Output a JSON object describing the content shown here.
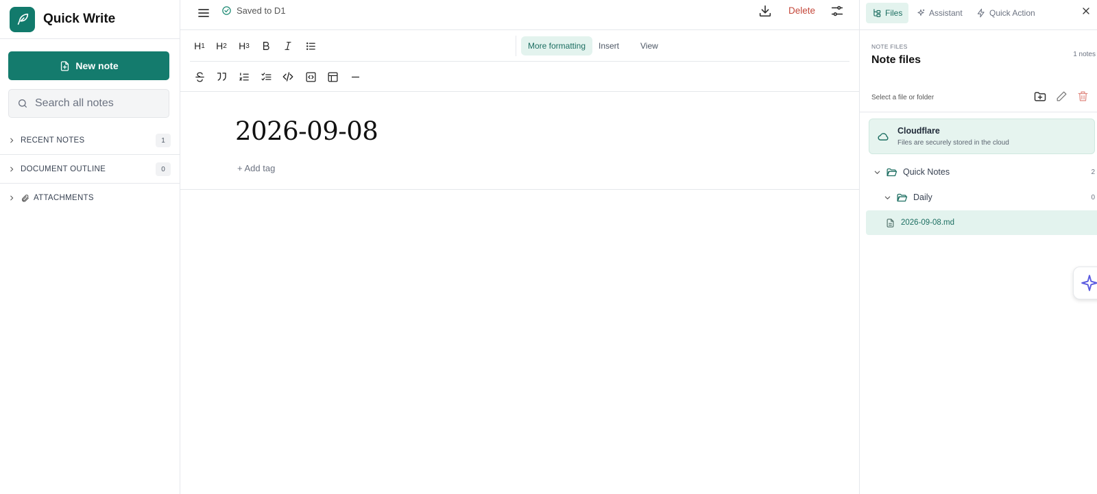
{
  "app": {
    "title": "Quick Write"
  },
  "sidebar": {
    "new_note_label": "New note",
    "search_placeholder": "Search all notes",
    "sections": [
      {
        "label": "RECENT NOTES",
        "count": "1"
      },
      {
        "label": "DOCUMENT OUTLINE",
        "count": "0"
      },
      {
        "label": "ATTACHMENTS"
      }
    ]
  },
  "topbar": {
    "status": "Saved to D1",
    "delete_label": "Delete"
  },
  "toolbar": {
    "headings": [
      {
        "base": "H",
        "level": "1"
      },
      {
        "base": "H",
        "level": "2"
      },
      {
        "base": "H",
        "level": "3"
      }
    ],
    "tabs": [
      {
        "label": "More formatting",
        "active": true
      },
      {
        "label": "Insert",
        "active": false
      },
      {
        "label": "View",
        "active": false
      }
    ],
    "icons": [
      "bold-icon",
      "italic-icon",
      "bullet-list-icon",
      "strikethrough-icon",
      "quote-icon",
      "ordered-list-icon",
      "task-list-icon",
      "code-icon",
      "code-block-icon",
      "table-icon",
      "horizontal-rule-icon"
    ]
  },
  "document": {
    "title": "2026-09-08",
    "add_tag_label": "+ Add tag"
  },
  "right_panel": {
    "tabs": [
      {
        "label": "Files",
        "active": true
      },
      {
        "label": "Assistant",
        "active": false
      },
      {
        "label": "Quick Action",
        "active": false
      }
    ],
    "kicker": "NOTE FILES",
    "title": "Note files",
    "count": "1 notes",
    "hint": "Select a file or folder",
    "storage": {
      "name": "Cloudflare",
      "description": "Files are securely stored in the cloud"
    },
    "tree": [
      {
        "label": "Quick Notes",
        "count": "2"
      },
      {
        "label": "Daily",
        "count": "0"
      },
      {
        "label": "2026-09-08.md"
      }
    ]
  },
  "colors": {
    "brand": "#147b6d",
    "accent_bg": "#e3f3ee",
    "danger": "#c4473a",
    "assistant_star": "#5b5be0"
  }
}
